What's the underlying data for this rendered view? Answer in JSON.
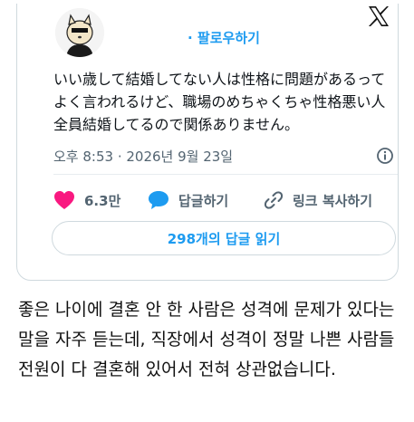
{
  "tweet": {
    "follow_label": "· 팔로우하기",
    "text": "いい歳して結婚してない人は性格に問題があるってよく言われるけど、職場のめちゃくちゃ性格悪い人全員結婚してるので関係ありません。",
    "timestamp": "오후 8:53 · 2026년 9월 23일",
    "likes": "6.3만",
    "reply_label": "답글하기",
    "copy_link_label": "링크 복사하기",
    "read_replies_label": "298개의 답글 읽기"
  },
  "translation": "좋은 나이에 결혼 안 한 사람은 성격에 문제가 있다는 말을 자주 듣는데, 직장에서 성격이 정말 나쁜 사람들 전원이 다 결혼해 있어서 전혀 상관없습니다.",
  "colors": {
    "accent": "#1d9bf0",
    "like": "#f91880",
    "muted": "#536471"
  },
  "icons": [
    "x-logo-icon",
    "info-icon",
    "heart-icon",
    "comment-icon",
    "link-icon"
  ]
}
